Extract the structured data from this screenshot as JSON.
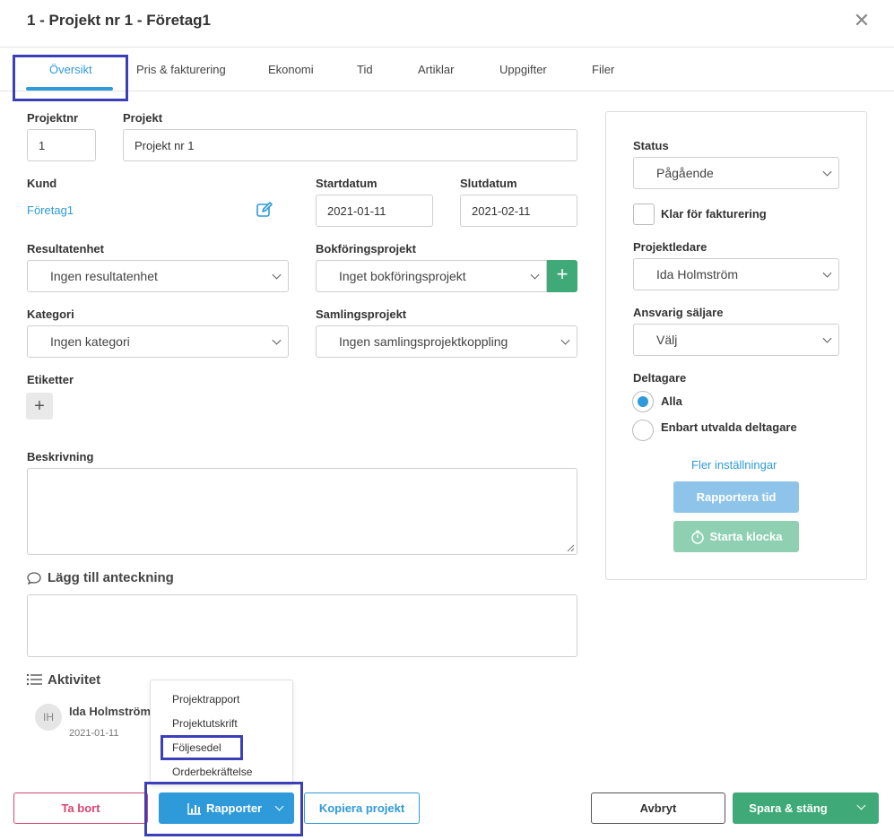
{
  "dialog": {
    "title": "1 - Projekt nr 1 - Företag1"
  },
  "tabs": [
    {
      "label": "Översikt"
    },
    {
      "label": "Pris & fakturering"
    },
    {
      "label": "Ekonomi"
    },
    {
      "label": "Tid"
    },
    {
      "label": "Artiklar"
    },
    {
      "label": "Uppgifter"
    },
    {
      "label": "Filer"
    }
  ],
  "form": {
    "projektnr_label": "Projektnr",
    "projektnr_value": "1",
    "projekt_label": "Projekt",
    "projekt_value": "Projekt nr 1",
    "kund_label": "Kund",
    "kund_value": "Företag1",
    "startdatum_label": "Startdatum",
    "startdatum_value": "2021-01-11",
    "slutdatum_label": "Slutdatum",
    "slutdatum_value": "2021-02-11",
    "resultatenhet_label": "Resultatenhet",
    "resultatenhet_value": "Ingen resultatenhet",
    "bokforingsprojekt_label": "Bokföringsprojekt",
    "bokforingsprojekt_value": "Inget bokföringsprojekt",
    "kategori_label": "Kategori",
    "kategori_value": "Ingen kategori",
    "samlingsprojekt_label": "Samlingsprojekt",
    "samlingsprojekt_value": "Ingen samlingsprojektkoppling",
    "etiketter_label": "Etiketter",
    "beskrivning_label": "Beskrivning",
    "anteckning_label": "Lägg till anteckning"
  },
  "activity": {
    "title": "Aktivitet",
    "entries": [
      {
        "initials": "IH",
        "name": "Ida Holmström",
        "date": "2021-01-11"
      }
    ]
  },
  "side": {
    "status_label": "Status",
    "status_value": "Pågående",
    "klar_label": "Klar för fakturering",
    "projektledare_label": "Projektledare",
    "projektledare_value": "Ida Holmström",
    "saljare_label": "Ansvarig säljare",
    "saljare_value": "Välj",
    "deltagare_label": "Deltagare",
    "deltagare_options": [
      "Alla",
      "Enbart utvalda deltagare"
    ],
    "fler_link": "Fler inställningar",
    "rapportera_tid": "Rapportera tid",
    "starta_klocka": "Starta klocka"
  },
  "report_menu": {
    "items": [
      "Projektrapport",
      "Projektutskrift",
      "Följesedel",
      "Orderbekräftelse"
    ]
  },
  "footer": {
    "delete": "Ta bort",
    "rapporter": "Rapporter",
    "kopiera": "Kopiera projekt",
    "avbryt": "Avbryt",
    "spara": "Spara & stäng"
  },
  "colors": {
    "accent": "#2f9ad9",
    "green": "#3faa78",
    "danger": "#d9456e",
    "highlight": "#3b3fb8"
  }
}
